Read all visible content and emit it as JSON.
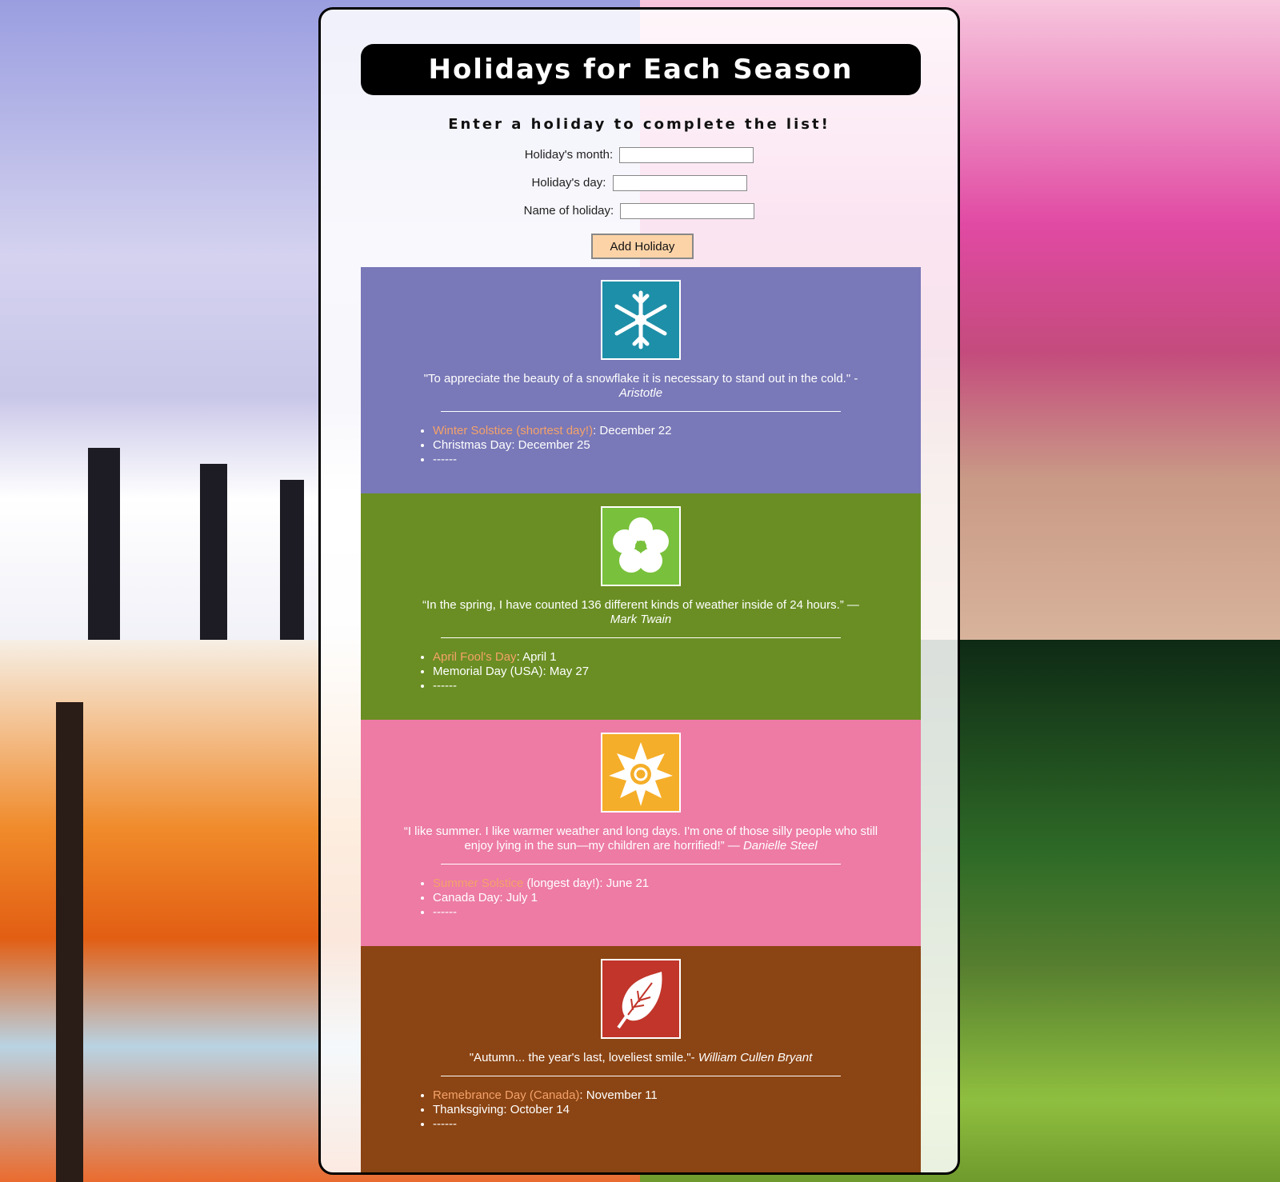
{
  "page": {
    "title": "Holidays for Each Season",
    "subtitle": "Enter a holiday to complete the list!"
  },
  "form": {
    "month_label": "Holiday's month:",
    "day_label": "Holiday's day:",
    "name_label": "Name of holiday:",
    "month_value": "",
    "day_value": "",
    "name_value": "",
    "button_label": "Add Holiday"
  },
  "colors": {
    "winter": "#7978b8",
    "spring": "#6a8e23",
    "summer": "#ed7ba4",
    "autumn": "#8b4413",
    "highlight": "#f4a26a",
    "button": "#fcd3a7"
  },
  "seasons": [
    {
      "icon": "snowflake-icon",
      "quote_text": "\"To appreciate the beauty of a snowflake it is necessary to stand out in the cold.\" -",
      "quote_author": "Aristotle",
      "items": [
        {
          "highlight": "Winter Solstice (shortest day!)",
          "rest": ": December 22"
        },
        {
          "highlight": "",
          "rest": "Christmas Day: December 25"
        },
        {
          "highlight": "",
          "rest": "------"
        }
      ]
    },
    {
      "icon": "flower-icon",
      "quote_text": "“In the spring, I have counted 136 different kinds of weather inside of 24 hours.” —",
      "quote_author": "Mark Twain",
      "items": [
        {
          "highlight": "April Fool's Day",
          "rest": ": April 1"
        },
        {
          "highlight": "",
          "rest": "Memorial Day (USA): May 27"
        },
        {
          "highlight": "",
          "rest": "------"
        }
      ]
    },
    {
      "icon": "sun-icon",
      "quote_text": "“I like summer. I like warmer weather and long days. I'm one of those silly people who still enjoy lying in the sun—my children are horrified!” —",
      "quote_author": "Danielle Steel",
      "items": [
        {
          "highlight": "Summer Solstice",
          "rest": " (longest day!): June 21"
        },
        {
          "highlight": "",
          "rest": "Canada Day: July 1"
        },
        {
          "highlight": "",
          "rest": "------"
        }
      ]
    },
    {
      "icon": "leaf-icon",
      "quote_text": "\"Autumn... the year's last, loveliest smile.\"-",
      "quote_author": "William Cullen Bryant",
      "items": [
        {
          "highlight": "Remebrance Day (Canada)",
          "rest": ": November 11"
        },
        {
          "highlight": "",
          "rest": "Thanksgiving: October 14"
        },
        {
          "highlight": "",
          "rest": "------"
        }
      ]
    }
  ]
}
